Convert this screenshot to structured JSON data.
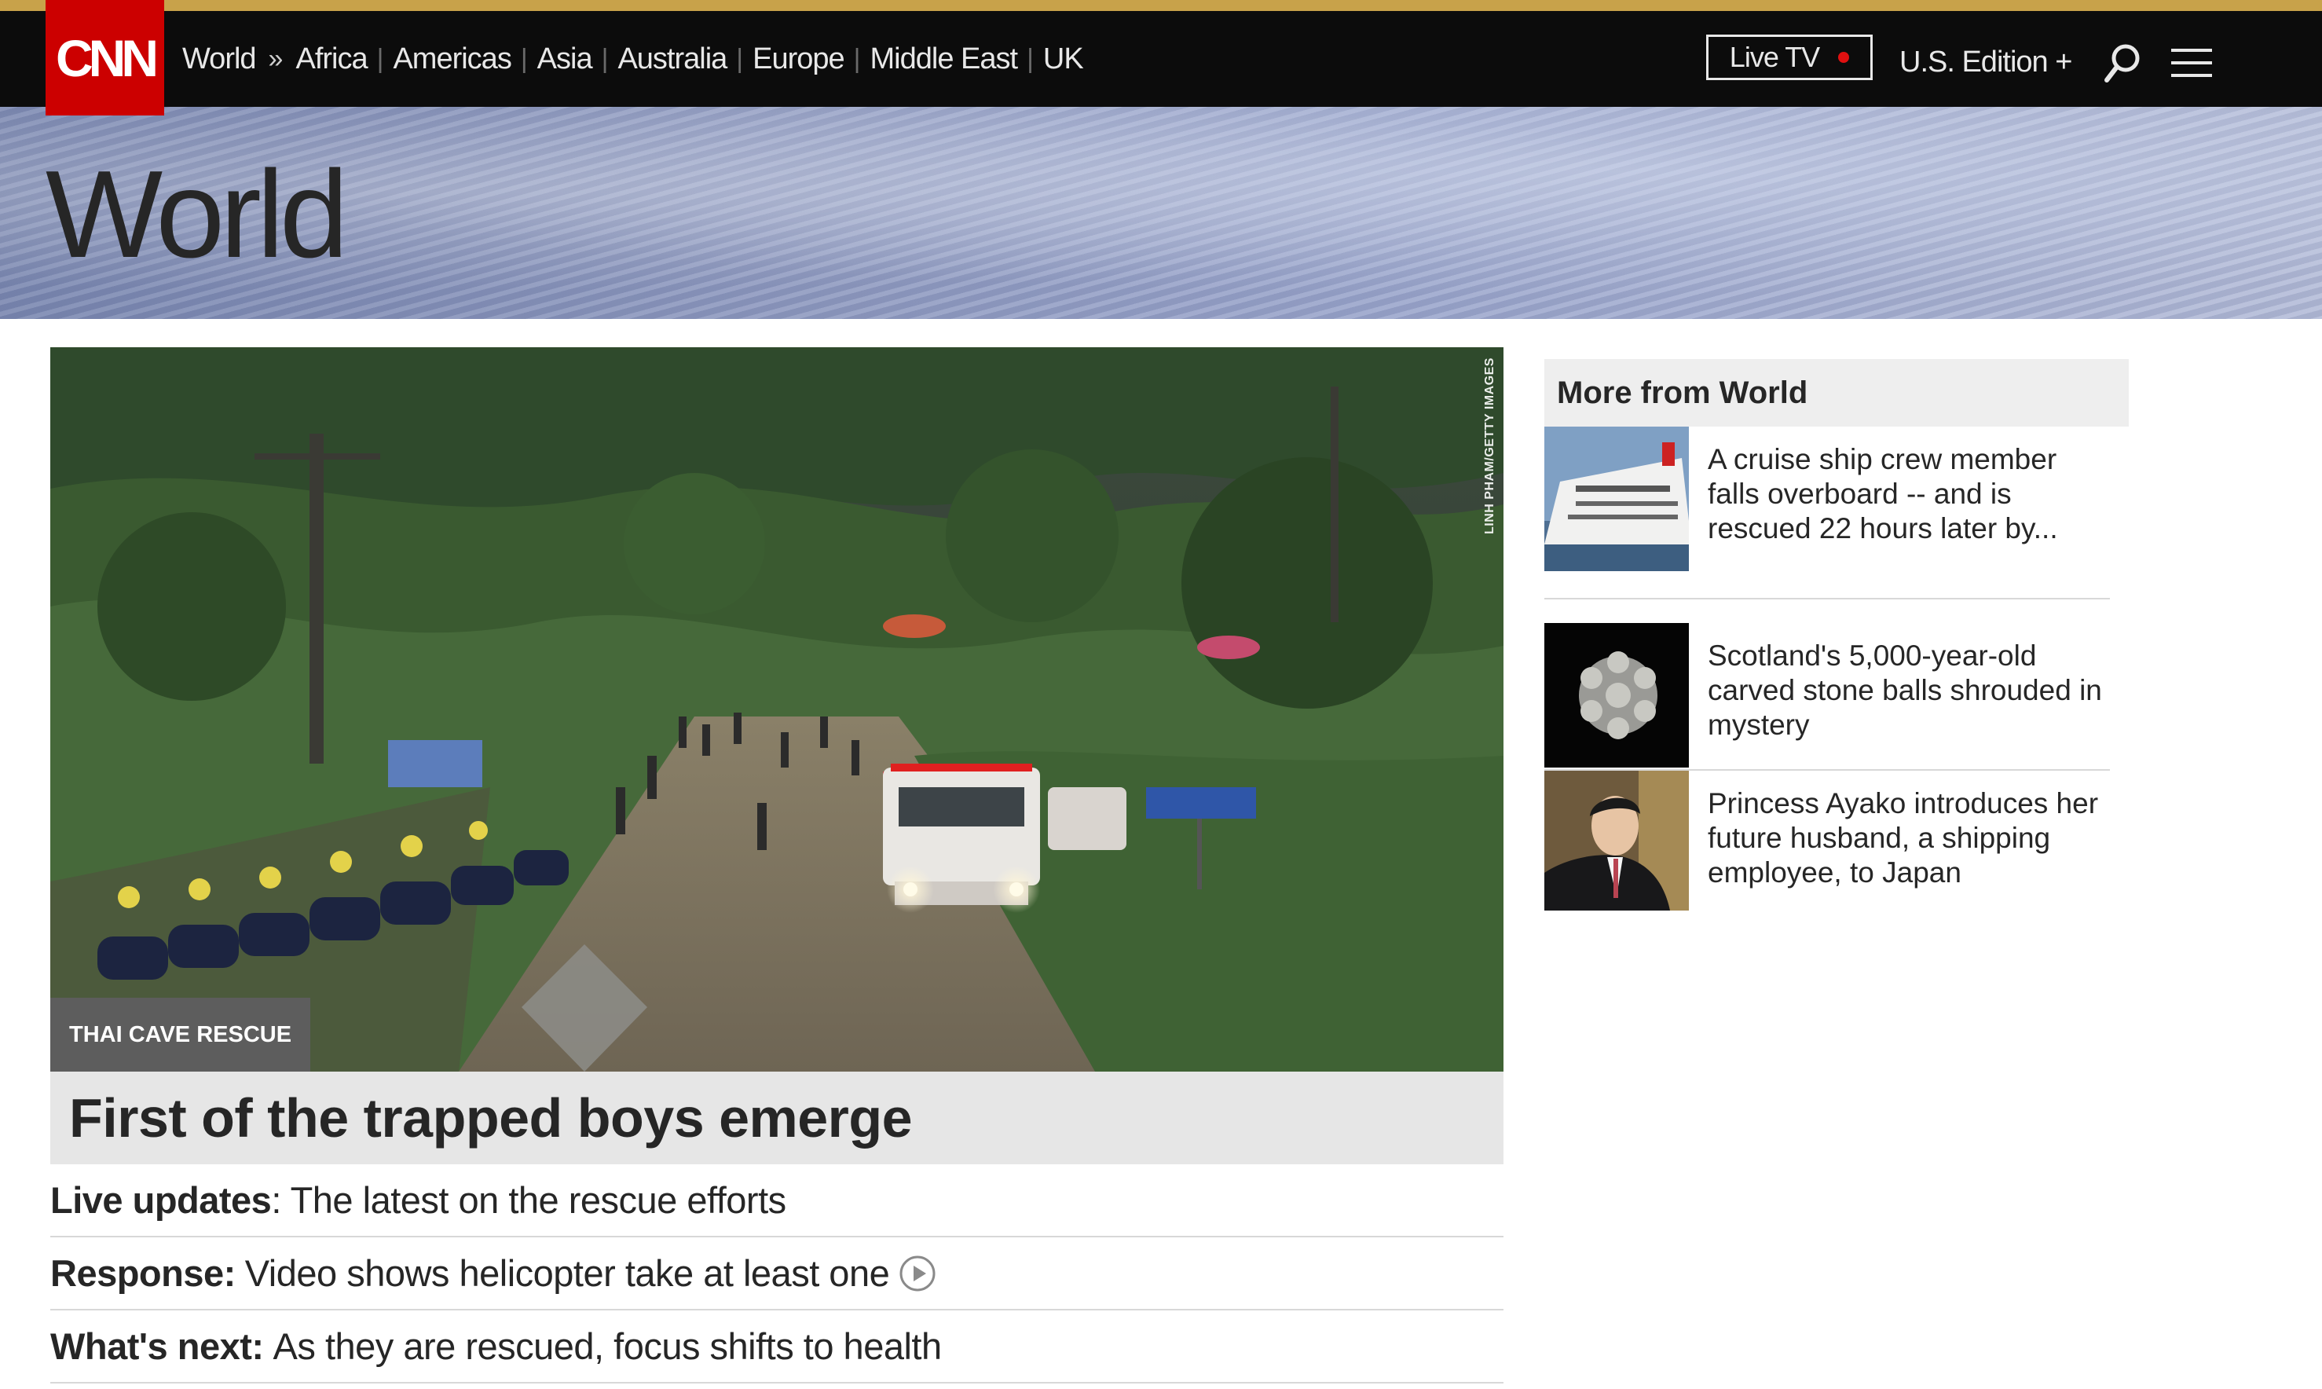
{
  "nav": {
    "logo_text": "CNN",
    "section": "World",
    "chevron": "»",
    "links": [
      "Africa",
      "Americas",
      "Asia",
      "Australia",
      "Europe",
      "Middle East",
      "UK"
    ],
    "live_tv": "Live TV",
    "edition": "U.S. Edition +",
    "search_icon": "search-icon",
    "menu_icon": "hamburger-menu-icon",
    "colors": {
      "bar": "#0c0c0c",
      "logo": "#cc0000",
      "live_dot": "#e01010",
      "top_line": "#c8a24a"
    }
  },
  "banner": {
    "title": "World"
  },
  "hero": {
    "photo_credit": "LINH PHAM/GETTY IMAGES",
    "kicker": "THAI CAVE RESCUE",
    "headline": "First of the trapped boys emerge",
    "sublinks": [
      {
        "label": "Live updates",
        "text": ": The latest on the rescue efforts",
        "video": false
      },
      {
        "label": "Response:",
        "text": "Video shows helicopter take at least one",
        "video": true
      },
      {
        "label": "What's next:",
        "text": "As they are rescued, focus shifts to health",
        "video": false
      }
    ]
  },
  "more_from_world": {
    "title": "More from World",
    "items": [
      {
        "headline": "A cruise ship crew member falls overboard -- and is rescued 22 hours later by...",
        "thumb": "cruise-ship-photo"
      },
      {
        "headline": "Scotland's 5,000-year-old carved stone balls shrouded in mystery",
        "thumb": "carved-stone-ball-photo"
      },
      {
        "headline": "Princess Ayako introduces her future husband, a shipping employee, to Japan",
        "thumb": "portrait-photo"
      }
    ]
  }
}
